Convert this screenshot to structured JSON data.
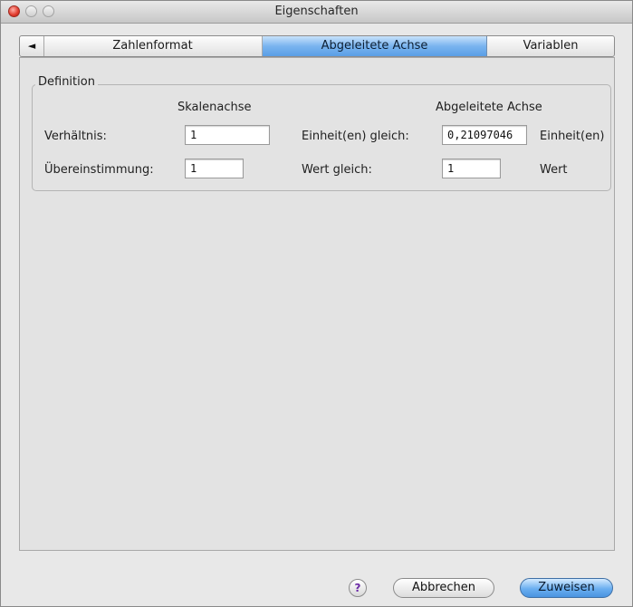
{
  "window": {
    "title": "Eigenschaften"
  },
  "tabs": {
    "scroll_left_icon": "◄",
    "items": [
      {
        "label": "Zahlenformat",
        "selected": false
      },
      {
        "label": "Abgeleitete Achse",
        "selected": true
      },
      {
        "label": "Variablen",
        "selected": false
      }
    ]
  },
  "definition": {
    "legend": "Definition",
    "headers": {
      "scale_axis": "Skalenachse",
      "derived_axis": "Abgeleitete Achse"
    },
    "ratio": {
      "label": "Verhältnis:",
      "scale_value": "1",
      "derived_label": "Einheit(en) gleich:",
      "derived_value": "0,21097046",
      "unit": "Einheit(en)"
    },
    "match": {
      "label": "Übereinstimmung:",
      "scale_value": "1",
      "derived_label": "Wert gleich:",
      "derived_value": "1",
      "unit": "Wert"
    }
  },
  "footer": {
    "help_glyph": "?",
    "cancel_label": "Abbrechen",
    "apply_label": "Zuweisen"
  },
  "colors": {
    "accent": "#6aaef0",
    "close_button": "#e0392b"
  }
}
